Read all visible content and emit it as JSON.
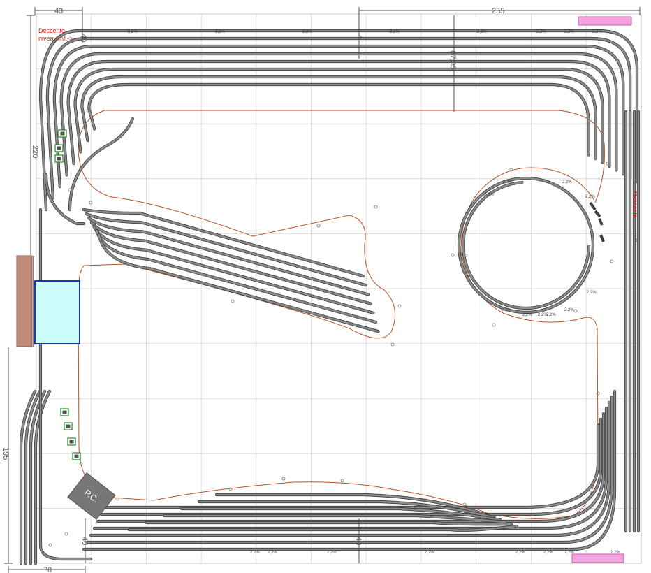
{
  "dimensions": {
    "top_left": "43",
    "top_right": "255",
    "left_upper": "220",
    "left_lower": "195",
    "bottom_left": "70",
    "depth_top_left": "40",
    "depth_top_mid": "4",
    "depth_top_inner": "67,95",
    "depth_bottom_left": "40",
    "depth_bottom_mid": "40"
  },
  "annotations": {
    "descente_line1": "Descente",
    "descente_line2": "niveau inf.->",
    "descente_right": "Descente",
    "pc_label": "P.C."
  },
  "grade_marks": {
    "top": [
      "2,2%",
      "2,2%",
      "2,2%",
      "2,2%",
      "2,2%",
      "2,2%",
      "2,2%",
      "2,2%"
    ],
    "helix": [
      "2,2%",
      "2,2%",
      "2,2%",
      "2,2%",
      "2,2%",
      "2,2%",
      "2,2%",
      "2,2%",
      "2,2%",
      "2,2%"
    ],
    "bottom": [
      "2,2%",
      "2,2%",
      "2,2%",
      "2,2%",
      "2,2%",
      "2,2%",
      "2,2%",
      "2,2%"
    ]
  },
  "colors": {
    "grid": "#d6d6d6",
    "track": "#8a8a8a",
    "track_edge": "#3d3d3d",
    "baseboard_outline": "#b5532a",
    "dimension": "#555555",
    "annotation_red": "#e0201a",
    "blue_frame": "#1a35b5",
    "blue_fill": "#ccfbfb",
    "brown_panel": "#c08a78",
    "pink_marker": "#f5a2e0",
    "pc_block": "#777777",
    "accessory_green": "#1e8c1e"
  }
}
